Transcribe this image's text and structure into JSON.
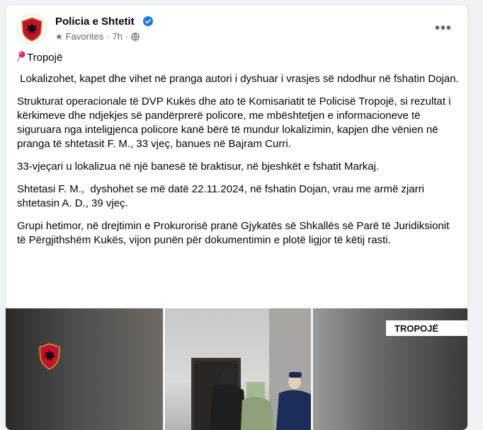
{
  "post": {
    "page_name": "Policia e Shtetit",
    "audience": "Favorites",
    "separator": "·",
    "time": "7h",
    "more_label": "•••",
    "location_line": "Tropojë",
    "paragraphs": [
      " Lokalizohet, kapet dhe vihet në pranga autori i dyshuar i vrasjes së ndodhur në fshatin Dojan.",
      "Strukturat operacionale të DVP Kukës dhe ato të Komisariatit të Policisë Tropojë, si rezultat i kërkimeve dhe ndjekjes së pandërprerë policore, me mbështetjen e informacioneve të siguruara nga inteligjenca policore kanë bërë të mundur lokalizimin, kapjen dhe vënien në pranga të shtetasit F. M., 33 vjeç, banues në Bajram Curri.",
      "33-vjeçari u lokalizua në një banesë të braktisur, në bjeshkët e fshatit Markaj.",
      "Shtetasi F. M.,  dyshohet se më datë 22.11.2024, në fshatin Dojan, vrau me armë zjarri shtetasin A. D., 39 vjeç.",
      "Grupi hetimor, në drejtimin e Prokurorisë pranë Gjykatës së Shkallës së Parë të Juridiksionit të Përgjithshëm Kukës, vijon punën për dokumentimin e plotë ligjor të këtij rasti."
    ]
  },
  "media": {
    "tag": "TROPOJË"
  },
  "colors": {
    "verified": "#1877f2",
    "secondary_text": "#65676b",
    "pin": "#e0245e",
    "emblem_red": "#c8102e"
  },
  "icons": {
    "verified": "verified-badge-icon",
    "audience": "star-icon",
    "privacy": "globe-icon",
    "more": "more-options-icon",
    "location": "round-pushpin-icon"
  }
}
